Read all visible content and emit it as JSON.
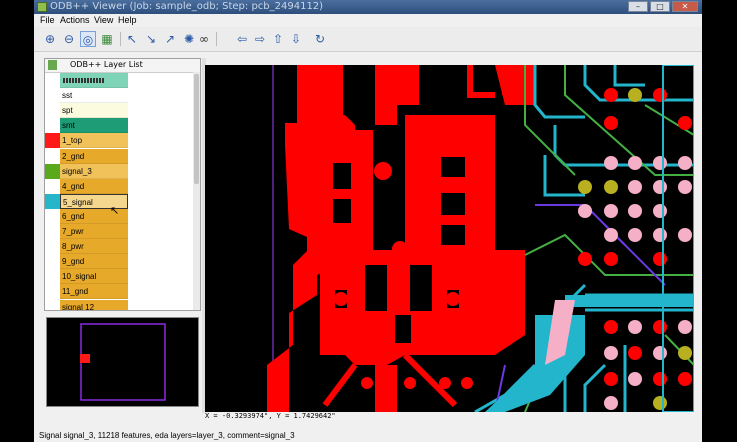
{
  "window": {
    "title": "ODB++ Viewer (Job: sample_odb; Step: pcb_2494112)"
  },
  "menu": [
    "File",
    "Actions",
    "View",
    "Help"
  ],
  "toolbar": {
    "buttons": [
      "zoom-in-icon",
      "zoom-out-icon",
      "zoom-window-icon",
      "zoom-fit-icon",
      "select-icon",
      "measure-icon",
      "snap-icon",
      "info-icon",
      "binoculars-icon",
      "pan-left-icon",
      "pan-right-icon",
      "pan-up-icon",
      "pan-down-icon",
      "redraw-icon"
    ]
  },
  "layer_panel": {
    "title": "ODB++ Layer List",
    "layers": [
      {
        "name": "",
        "swatch": "",
        "fill": "#7fd4b8"
      },
      {
        "name": "sst",
        "swatch": "",
        "fill": "#ffffff"
      },
      {
        "name": "spt",
        "swatch": "",
        "fill": "#fbfbdf"
      },
      {
        "name": "smt",
        "swatch": "",
        "fill": "#1d9c75"
      },
      {
        "name": "1_top",
        "swatch": "#ff1a1a",
        "fill": "#f2c25a"
      },
      {
        "name": "2_gnd",
        "swatch": "",
        "fill": "#e7a92a"
      },
      {
        "name": "signal_3",
        "swatch": "#5aa81c",
        "fill": "#f2c25a"
      },
      {
        "name": "4_gnd",
        "swatch": "",
        "fill": "#e7a92a"
      },
      {
        "name": "5_signal",
        "swatch": "#27b6c9",
        "fill": "#f6d78e"
      },
      {
        "name": "6_gnd",
        "swatch": "",
        "fill": "#e7a92a"
      },
      {
        "name": "7_pwr",
        "swatch": "",
        "fill": "#e7a92a"
      },
      {
        "name": "8_pwr",
        "swatch": "",
        "fill": "#e7a92a"
      },
      {
        "name": "9_gnd",
        "swatch": "",
        "fill": "#e7a92a"
      },
      {
        "name": "10_signal",
        "swatch": "",
        "fill": "#e7a92a"
      },
      {
        "name": "11_gnd",
        "swatch": "",
        "fill": "#e7a92a"
      },
      {
        "name": "signal 12",
        "swatch": "",
        "fill": "#e7a92a"
      }
    ]
  },
  "coordinates": "X = -0.3293974\", Y = 1.7429642\"",
  "status": "Signal signal_3, 11218 features, eda layers=layer_3, comment=signal_3",
  "colors": {
    "copper": "#ff0000",
    "trace_cyan": "#22b5cc",
    "trace_green": "#44b044",
    "via_pink": "#f5b0c8",
    "via_olive": "#b8b020"
  }
}
